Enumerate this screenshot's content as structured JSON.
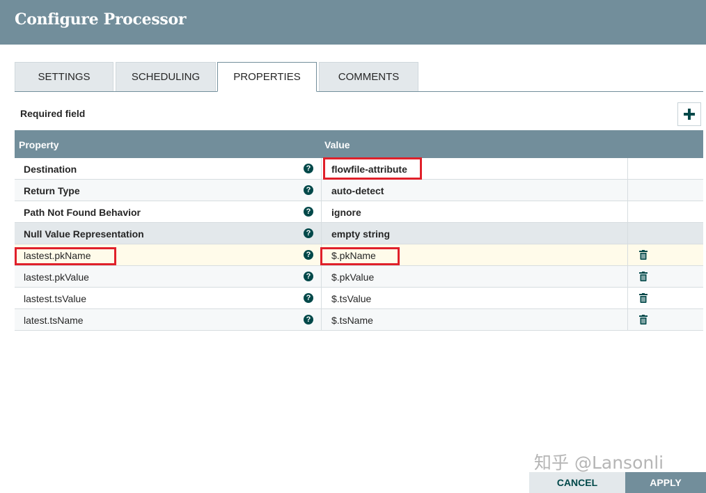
{
  "dialog": {
    "title": "Configure Processor"
  },
  "tabs": [
    {
      "label": "SETTINGS",
      "active": false
    },
    {
      "label": "SCHEDULING",
      "active": false
    },
    {
      "label": "PROPERTIES",
      "active": true
    },
    {
      "label": "COMMENTS",
      "active": false
    }
  ],
  "properties": {
    "required_label": "Required field",
    "add_icon": "plus-icon",
    "columns": {
      "property": "Property",
      "value": "Value"
    },
    "rows": [
      {
        "name": "Destination",
        "value": "flowfile-attribute",
        "required": true,
        "deletable": false
      },
      {
        "name": "Return Type",
        "value": "auto-detect",
        "required": true,
        "deletable": false
      },
      {
        "name": "Path Not Found Behavior",
        "value": "ignore",
        "required": true,
        "deletable": false
      },
      {
        "name": "Null Value Representation",
        "value": "empty string",
        "required": true,
        "deletable": false
      },
      {
        "name": "lastest.pkName",
        "value": "$.pkName",
        "required": false,
        "deletable": true
      },
      {
        "name": "lastest.pkValue",
        "value": "$.pkValue",
        "required": false,
        "deletable": true
      },
      {
        "name": "lastest.tsValue",
        "value": "$.tsValue",
        "required": false,
        "deletable": true
      },
      {
        "name": "latest.tsName",
        "value": "$.tsName",
        "required": false,
        "deletable": true
      }
    ]
  },
  "footer": {
    "cancel_label": "CANCEL",
    "apply_label": "APPLY"
  },
  "watermark": "知乎 @Lansonli",
  "colors": {
    "header": "#728e9b",
    "accent": "#004849",
    "highlight_border": "#e0202a",
    "selected_row": "#fffbea"
  }
}
